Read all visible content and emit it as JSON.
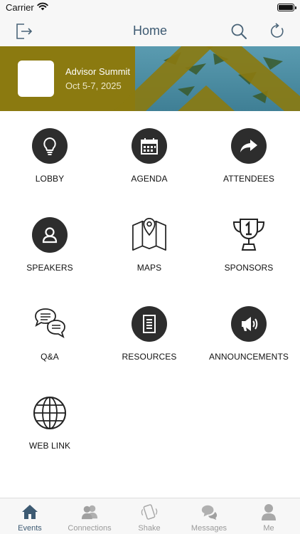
{
  "status_bar": {
    "carrier": "Carrier"
  },
  "nav": {
    "title": "Home",
    "logout_icon": "logout-icon",
    "search_icon": "search-icon",
    "refresh_icon": "refresh-icon"
  },
  "banner": {
    "title": "Advisor Summit",
    "dates": "Oct 5-7, 2025",
    "accent_color": "#8b7a10"
  },
  "tiles": [
    {
      "label": "LOBBY",
      "icon": "lightbulb-icon"
    },
    {
      "label": "AGENDA",
      "icon": "calendar-icon"
    },
    {
      "label": "ATTENDEES",
      "icon": "share-arrow-icon"
    },
    {
      "label": "SPEAKERS",
      "icon": "person-icon"
    },
    {
      "label": "MAPS",
      "icon": "map-icon"
    },
    {
      "label": "SPONSORS",
      "icon": "trophy-icon"
    },
    {
      "label": "Q&A",
      "icon": "chat-bubbles-icon"
    },
    {
      "label": "RESOURCES",
      "icon": "document-icon"
    },
    {
      "label": "ANNOUNCEMENTS",
      "icon": "megaphone-icon"
    },
    {
      "label": "WEB LINK",
      "icon": "globe-icon"
    }
  ],
  "tab_bar": {
    "active_color": "#3d5a72",
    "inactive_color": "#9a9a9a",
    "tabs": [
      {
        "label": "Events",
        "icon": "home-icon",
        "active": true
      },
      {
        "label": "Connections",
        "icon": "people-icon",
        "active": false
      },
      {
        "label": "Shake",
        "icon": "shake-phone-icon",
        "active": false
      },
      {
        "label": "Messages",
        "icon": "messages-icon",
        "active": false
      },
      {
        "label": "Me",
        "icon": "profile-icon",
        "active": false
      }
    ]
  }
}
